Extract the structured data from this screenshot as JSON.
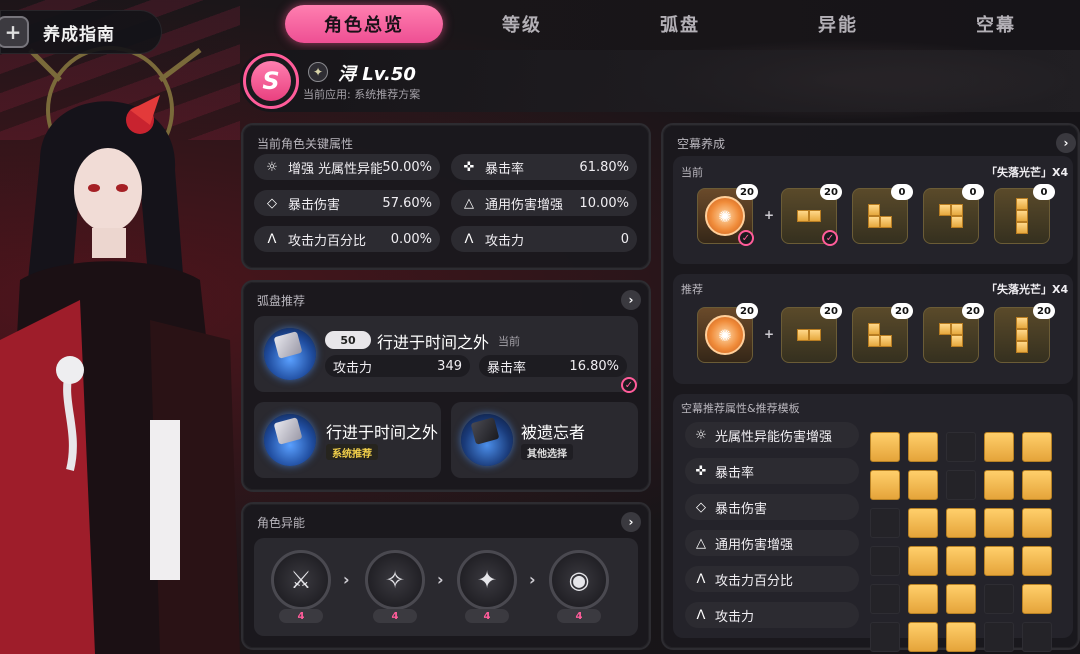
{
  "header": {
    "guide_label": "养成指南",
    "guide_icon": "plus-icon"
  },
  "tabs": [
    {
      "label": "角色总览",
      "active": true
    },
    {
      "label": "等级",
      "active": false
    },
    {
      "label": "弧盘",
      "active": false
    },
    {
      "label": "异能",
      "active": false
    },
    {
      "label": "空幕",
      "active": false
    }
  ],
  "character": {
    "rank": "S",
    "name": "浔 Lv.50",
    "subtitle": "当前应用: 系统推荐方案"
  },
  "key_attributes": {
    "title": "当前角色关键属性",
    "stats": [
      {
        "label": "增强 光属性异能伤害增强",
        "value": "50.00%"
      },
      {
        "label": "暴击率",
        "value": "61.80%"
      },
      {
        "label": "暴击伤害",
        "value": "57.60%"
      },
      {
        "label": "通用伤害增强",
        "value": "10.00%"
      },
      {
        "label": "攻击力百分比",
        "value": "0.00%"
      },
      {
        "label": "攻击力",
        "value": "0"
      }
    ]
  },
  "disc_recommend": {
    "title": "弧盘推荐",
    "current": {
      "level": "50",
      "name": "行进于时间之外",
      "tag": "当前",
      "stats": [
        {
          "label": "攻击力",
          "value": "349"
        },
        {
          "label": "暴击率",
          "value": "16.80%"
        }
      ]
    },
    "options": [
      {
        "name": "行进于时间之外",
        "tag": "系统推荐"
      },
      {
        "name": "被遗忘者",
        "tag": "其他选择"
      }
    ]
  },
  "abilities": {
    "title": "角色异能",
    "levels": [
      "4",
      "4",
      "4",
      "4"
    ]
  },
  "void": {
    "title": "空幕养成",
    "current": {
      "label": "当前",
      "set_name": "「失落光芒」X4",
      "counts": [
        "20",
        "20",
        "0",
        "0",
        "0"
      ]
    },
    "recommended": {
      "label": "推荐",
      "set_name": "「失落光芒」X4",
      "counts": [
        "20",
        "20",
        "20",
        "20",
        "20"
      ]
    },
    "template": {
      "title": "空幕推荐属性&推荐模板",
      "items": [
        "光属性异能伤害增强",
        "暴击率",
        "暴击伤害",
        "通用伤害增强",
        "攻击力百分比",
        "攻击力"
      ]
    }
  },
  "colors": {
    "accent": "#ff5c9a",
    "gold": "#f2c05a",
    "panel": "#1a191d"
  }
}
